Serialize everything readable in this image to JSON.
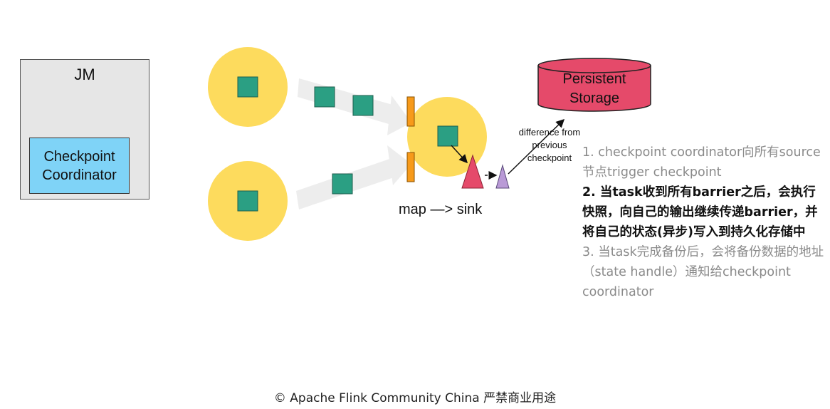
{
  "jm": {
    "title": "JM",
    "coordinator": "Checkpoint Coordinator"
  },
  "storage": {
    "label": "Persistent Storage"
  },
  "diff_label": "difference from previous checkpoint",
  "operator_label": "map —> sink",
  "steps": [
    {
      "text": "1. checkpoint coordinator向所有source节点trigger checkpoint",
      "style": "gray"
    },
    {
      "text": "2. 当task收到所有barrier之后，会执行快照，向自己的输出继续传递barrier，并将自己的状态(异步)写入到持久化存储中",
      "style": "dark"
    },
    {
      "text": "3. 当task完成备份后，会将备份数据的地址（state handle）通知给checkpoint coordinator",
      "style": "gray"
    }
  ],
  "footer": "© Apache Flink Community China  严禁商业用途",
  "colors": {
    "node": "#fddb5d",
    "record": "#2b9f83",
    "barrier": "#f79a1a",
    "storage": "#e54a6a",
    "snapshot": "#e54a6a",
    "diff": "#b99ad6",
    "coordinator": "#7fd3f7",
    "jm": "#e6e6e6",
    "stream": "#ededed"
  }
}
